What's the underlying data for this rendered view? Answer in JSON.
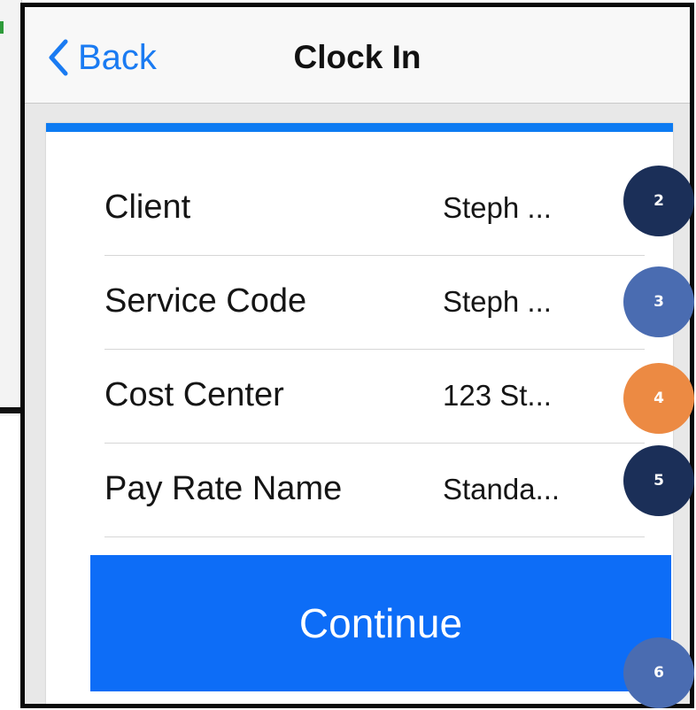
{
  "navbar": {
    "back_label": "Back",
    "title": "Clock In"
  },
  "form": {
    "rows": [
      {
        "label": "Client",
        "value": "Steph ..."
      },
      {
        "label": "Service Code",
        "value": "Steph ..."
      },
      {
        "label": "Cost Center",
        "value": "123 St..."
      },
      {
        "label": "Pay Rate Name",
        "value": "Standa..."
      }
    ],
    "continue_label": "Continue"
  },
  "callouts": [
    {
      "number": "2",
      "color": "#1b2f58"
    },
    {
      "number": "3",
      "color": "#4a6cb1"
    },
    {
      "number": "4",
      "color": "#ec8a43"
    },
    {
      "number": "5",
      "color": "#1b2f58"
    },
    {
      "number": "6",
      "color": "#4a6cb1"
    }
  ],
  "colors": {
    "accent": "#0d7bf2",
    "button": "#0d6df7"
  }
}
